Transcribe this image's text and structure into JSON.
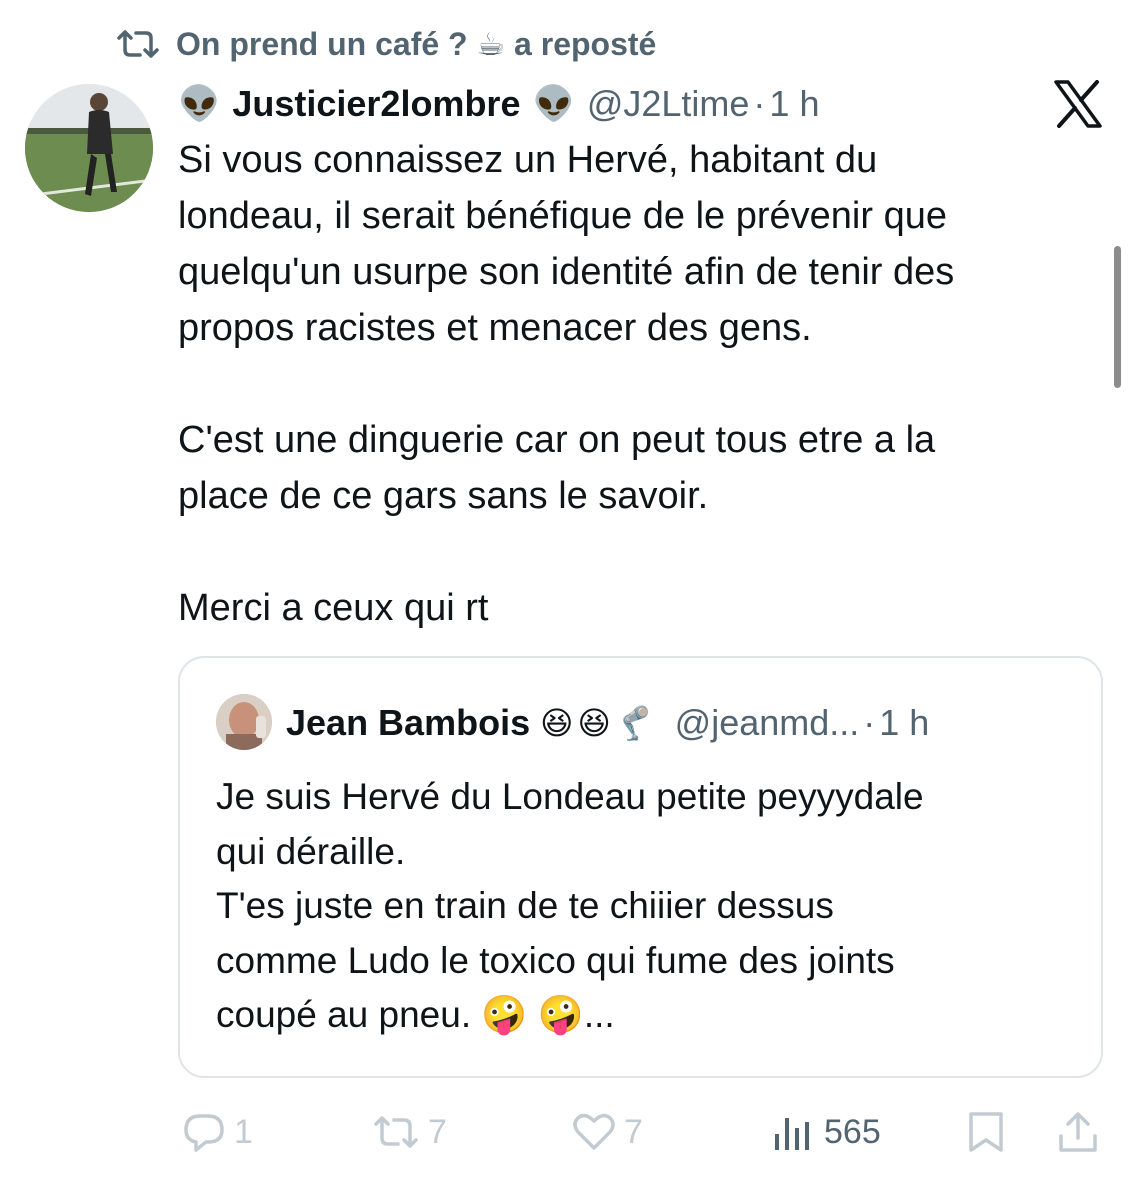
{
  "repost": {
    "text": "On prend un café ? ☕ a reposté"
  },
  "tweet": {
    "emoji": "👽",
    "name": "Justicier2lombre",
    "handle": "@J2Ltime",
    "separator": "·",
    "time": "1 h",
    "text": "Si vous connaissez un Hervé, habitant du\nlondeau, il serait bénéfique de le prévenir que\nquelqu'un usurpe son identité afin de tenir des\npropos racistes et menacer des gens.\n\nC'est une dinguerie car on peut tous etre a la\nplace de ce gars sans le savoir.\n\nMerci a ceux qui rt"
  },
  "quoted": {
    "name": "Jean Bambois",
    "emojis": [
      "😆",
      "😆",
      "🦿"
    ],
    "handle": "@jeanmd...",
    "separator": "·",
    "time": "1 h",
    "text": "Je suis Hervé du Londeau petite peyyydale\nqui déraille.\nT'es juste en train de te chiiier dessus\ncomme Ludo le toxico qui fume des joints\ncoupé au pneu. 🤪 🤪..."
  },
  "actions": {
    "replies": "1",
    "reposts": "7",
    "likes": "7",
    "views": "565"
  },
  "icons": {
    "repost": "repost-icon",
    "reply": "reply-icon",
    "like": "heart-icon",
    "views": "views-icon",
    "bookmark": "bookmark-icon",
    "share": "share-icon",
    "logo": "x-logo-icon"
  },
  "colors": {
    "text": "#0f1419",
    "muted": "#536471",
    "faded": "#c3cbd2",
    "border": "#dfe4e8"
  }
}
